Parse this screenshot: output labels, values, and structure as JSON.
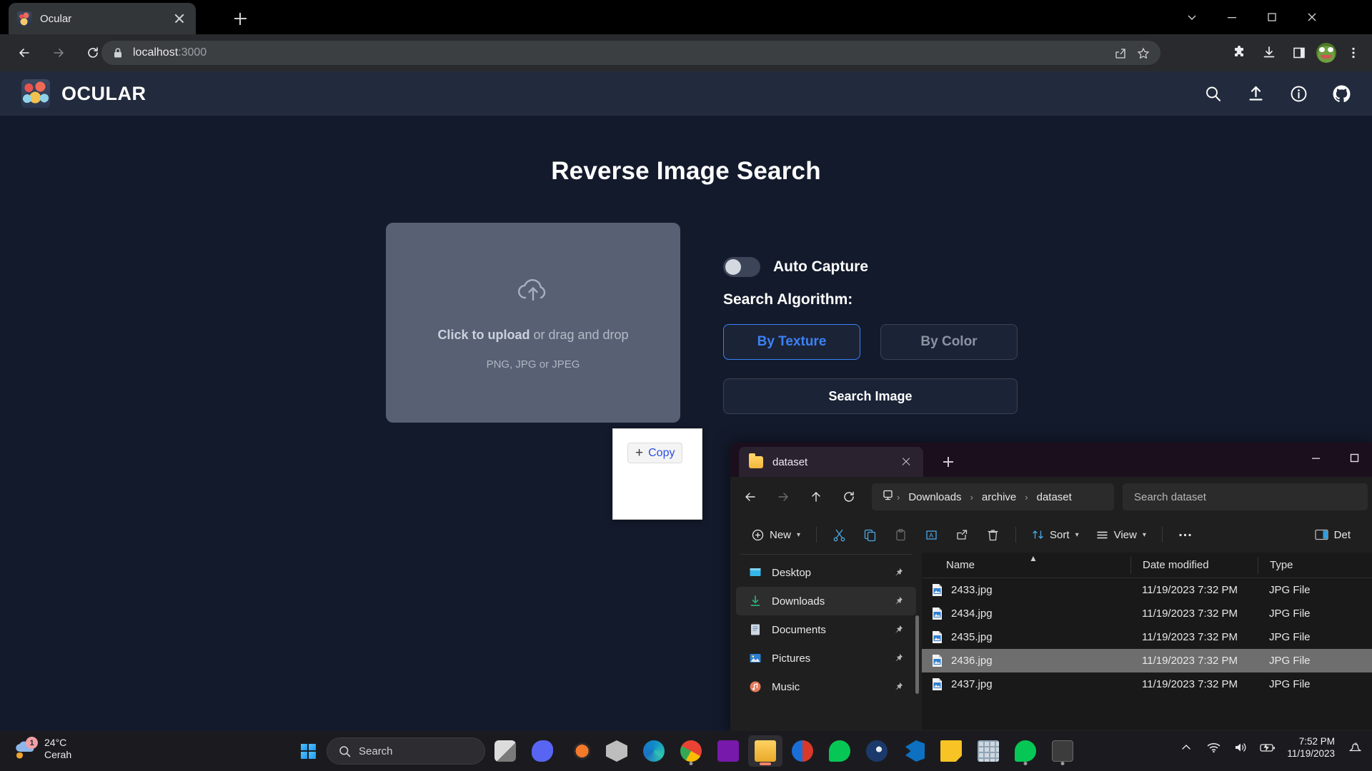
{
  "browser": {
    "tab": {
      "title": "Ocular",
      "favicon": "ocular-favicon"
    },
    "url_host": "localhost",
    "url_port": ":3000",
    "icons": [
      "share-icon",
      "bookmark-star-icon",
      "extensions-puzzle-icon",
      "downloads-icon",
      "side-panel-icon",
      "profile-avatar-icon",
      "chrome-menu-icon"
    ],
    "window_controls": [
      "chevron-down-icon",
      "minimize-icon",
      "maximize-icon",
      "close-icon"
    ],
    "nav": [
      "back-icon",
      "forward-icon",
      "reload-icon"
    ]
  },
  "app": {
    "brand": "OCULAR",
    "header_icons": [
      "search-icon",
      "upload-icon",
      "info-icon",
      "github-icon"
    ],
    "title": "Reverse Image Search",
    "dropzone": {
      "main_bold": "Click to upload",
      "main_rest": " or drag and drop",
      "sub": "PNG, JPG or JPEG"
    },
    "controls": {
      "auto_capture_label": "Auto Capture",
      "auto_capture_on": false,
      "algorithm_label": "Search Algorithm:",
      "algo_texture": "By Texture",
      "algo_color": "By Color",
      "active_algo": "By Texture",
      "search_button": "Search Image"
    },
    "drag_ghost": {
      "action": "Copy",
      "plus": "+"
    },
    "accent": "#3b82f6"
  },
  "explorer": {
    "tab_title": "dataset",
    "breadcrumb": [
      "Downloads",
      "archive",
      "dataset"
    ],
    "breadcrumb_root_icon": "this-pc-icon",
    "search_placeholder": "Search dataset",
    "nav_icons": [
      "back-icon",
      "forward-icon",
      "up-icon",
      "refresh-icon"
    ],
    "toolbar": {
      "new": "New",
      "sort": "Sort",
      "view": "View",
      "details": "Det",
      "icons": [
        "cut-icon",
        "copy-icon",
        "paste-icon",
        "rename-icon",
        "share-icon",
        "delete-icon",
        "more-icon"
      ]
    },
    "sidebar": [
      {
        "label": "Desktop",
        "icon": "desktop-icon",
        "pinned": true,
        "selected": false
      },
      {
        "label": "Downloads",
        "icon": "downloads-icon",
        "pinned": true,
        "selected": true
      },
      {
        "label": "Documents",
        "icon": "documents-icon",
        "pinned": true,
        "selected": false
      },
      {
        "label": "Pictures",
        "icon": "pictures-icon",
        "pinned": true,
        "selected": false
      },
      {
        "label": "Music",
        "icon": "music-icon",
        "pinned": true,
        "selected": false
      }
    ],
    "columns": [
      "Name",
      "Date modified",
      "Type"
    ],
    "sort_column": "Name",
    "rows": [
      {
        "name": "2433.jpg",
        "date": "11/19/2023 7:32 PM",
        "type": "JPG File",
        "selected": false
      },
      {
        "name": "2434.jpg",
        "date": "11/19/2023 7:32 PM",
        "type": "JPG File",
        "selected": false
      },
      {
        "name": "2435.jpg",
        "date": "11/19/2023 7:32 PM",
        "type": "JPG File",
        "selected": false
      },
      {
        "name": "2436.jpg",
        "date": "11/19/2023 7:32 PM",
        "type": "JPG File",
        "selected": true
      },
      {
        "name": "2437.jpg",
        "date": "11/19/2023 7:32 PM",
        "type": "JPG File",
        "selected": false
      }
    ],
    "window_controls": [
      "minimize-icon",
      "maximize-icon"
    ]
  },
  "taskbar": {
    "weather": {
      "temp": "24°C",
      "condition": "Cerah",
      "badge": "1"
    },
    "search_placeholder": "Search",
    "apps": [
      {
        "name": "task-view",
        "running": false
      },
      {
        "name": "discord",
        "running": false
      },
      {
        "name": "blender",
        "running": false
      },
      {
        "name": "unity",
        "running": false
      },
      {
        "name": "edge",
        "running": false
      },
      {
        "name": "chrome",
        "running": true
      },
      {
        "name": "onenote",
        "running": false
      },
      {
        "name": "file-explorer",
        "running": true,
        "active": true
      },
      {
        "name": "opera-gx",
        "running": false
      },
      {
        "name": "line",
        "running": false
      },
      {
        "name": "steam",
        "running": false
      },
      {
        "name": "vscode",
        "running": false
      },
      {
        "name": "sticky-notes",
        "running": false
      },
      {
        "name": "calculator",
        "running": false
      },
      {
        "name": "line-alt",
        "running": true
      },
      {
        "name": "terminal",
        "running": true
      }
    ],
    "tray_icons": [
      "chevron-up-icon",
      "wifi-icon",
      "volume-icon",
      "battery-icon",
      "notifications-icon"
    ],
    "clock_time": "7:52 PM",
    "clock_date": "11/19/2023"
  }
}
